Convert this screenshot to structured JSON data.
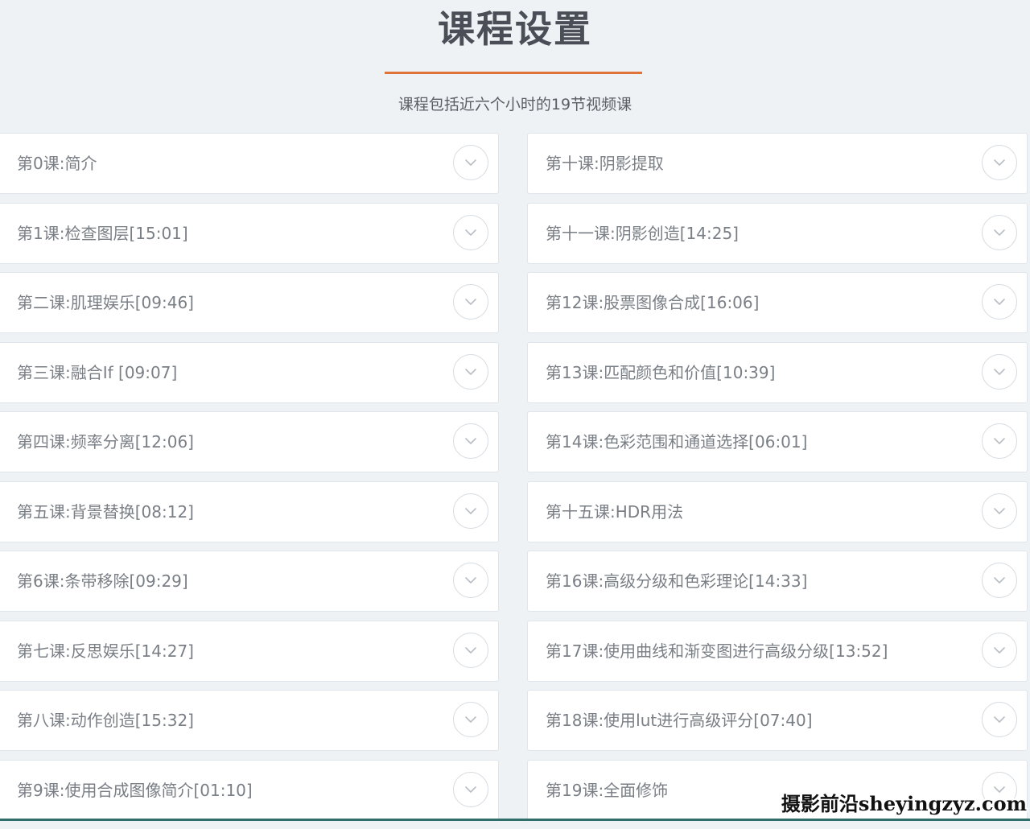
{
  "header": {
    "title": "课程设置",
    "subtitle": "课程包括近六个小时的19节视频课"
  },
  "lessons_left": [
    {
      "label": "第0课:简介"
    },
    {
      "label": "第1课:检查图层[15:01]"
    },
    {
      "label": "第二课:肌理娱乐[09:46]"
    },
    {
      "label": "第三课:融合If [09:07]"
    },
    {
      "label": "第四课:频率分离[12:06]"
    },
    {
      "label": "第五课:背景替换[08:12]"
    },
    {
      "label": "第6课:条带移除[09:29]"
    },
    {
      "label": "第七课:反思娱乐[14:27]"
    },
    {
      "label": "第八课:动作创造[15:32]"
    },
    {
      "label": "第9课:使用合成图像简介[01:10]"
    }
  ],
  "lessons_right": [
    {
      "label": "第十课:阴影提取"
    },
    {
      "label": "第十一课:阴影创造[14:25]"
    },
    {
      "label": "第12课:股票图像合成[16:06]"
    },
    {
      "label": "第13课:匹配颜色和价值[10:39]"
    },
    {
      "label": "第14课:色彩范围和通道选择[06:01]"
    },
    {
      "label": "第十五课:HDR用法"
    },
    {
      "label": "第16课:高级分级和色彩理论[14:33]"
    },
    {
      "label": "第17课:使用曲线和渐变图进行高级分级[13:52]"
    },
    {
      "label": "第18课:使用lut进行高级评分[07:40]"
    },
    {
      "label": "第19课:全面修饰"
    }
  ],
  "expand_icon": "chevron-down-icon",
  "watermark": "摄影前沿sheyingzyz.com",
  "colors": {
    "background": "#eef2f5",
    "accent": "#e0733a",
    "title": "#4a4f57",
    "label": "#7a7f86"
  }
}
